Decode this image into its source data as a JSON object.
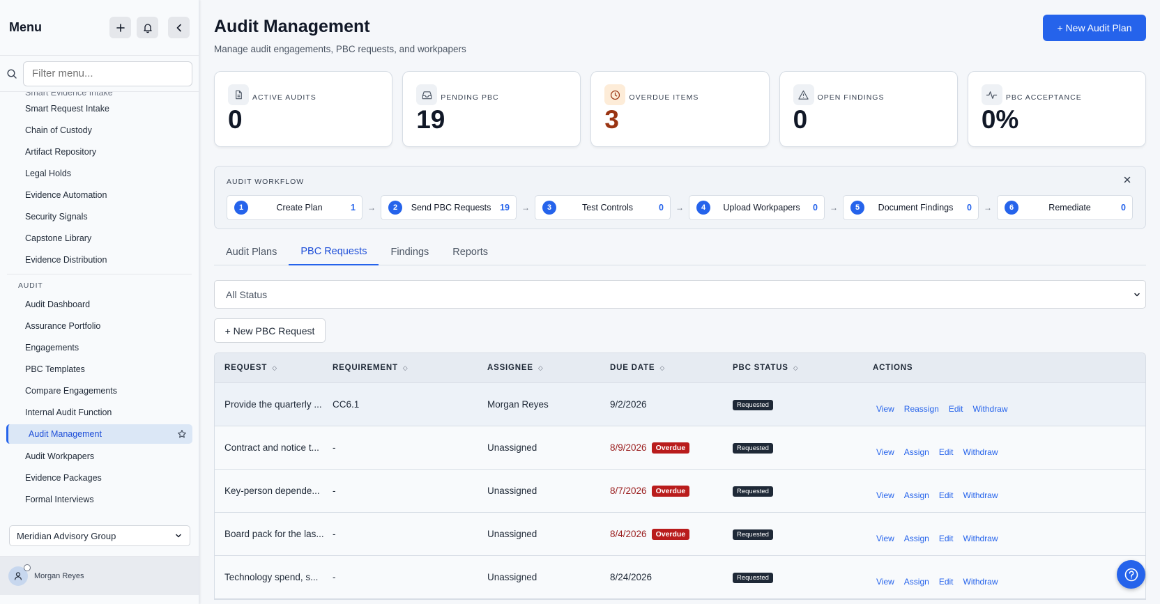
{
  "sidebar": {
    "title": "Menu",
    "filter_placeholder": "Filter menu...",
    "clipped_item": "Smart Evidence Intake",
    "items_top": [
      "Smart Request Intake",
      "Chain of Custody",
      "Artifact Repository",
      "Legal Holds",
      "Evidence Automation",
      "Security Signals",
      "Capstone Library",
      "Evidence Distribution"
    ],
    "section_label": "AUDIT",
    "items_audit_before": [
      "Audit Dashboard",
      "Assurance Portfolio",
      "Engagements",
      "PBC Templates",
      "Compare Engagements",
      "Internal Audit Function"
    ],
    "active_item": "Audit Management",
    "items_audit_after": [
      "Audit Workpapers",
      "Evidence Packages",
      "Formal Interviews"
    ],
    "organization": "Meridian Advisory Group",
    "user_name": "Morgan Reyes"
  },
  "header": {
    "title": "Audit Management",
    "subtitle": "Manage audit engagements, PBC requests, and workpapers",
    "new_plan_label": "+ New Audit Plan"
  },
  "stats": [
    {
      "label": "ACTIVE AUDITS",
      "value": "0",
      "icon": "document-icon"
    },
    {
      "label": "PENDING PBC",
      "value": "19",
      "icon": "inbox-icon"
    },
    {
      "label": "OVERDUE ITEMS",
      "value": "3",
      "icon": "clock-icon"
    },
    {
      "label": "OPEN FINDINGS",
      "value": "0",
      "icon": "alert-triangle-icon"
    },
    {
      "label": "PBC ACCEPTANCE",
      "value": "0%",
      "icon": "activity-icon"
    }
  ],
  "workflow": {
    "title": "AUDIT WORKFLOW",
    "arrow": "→",
    "steps": [
      {
        "num": "1",
        "label": "Create Plan",
        "count": "1"
      },
      {
        "num": "2",
        "label": "Send PBC Requests",
        "count": "19"
      },
      {
        "num": "3",
        "label": "Test Controls",
        "count": "0"
      },
      {
        "num": "4",
        "label": "Upload Workpapers",
        "count": "0"
      },
      {
        "num": "5",
        "label": "Document Findings",
        "count": "0"
      },
      {
        "num": "6",
        "label": "Remediate",
        "count": "0"
      }
    ]
  },
  "tabs": [
    "Audit Plans",
    "PBC Requests",
    "Findings",
    "Reports"
  ],
  "active_tab": "PBC Requests",
  "filter": {
    "status_selected": "All Status"
  },
  "new_pbc_label": "+ New PBC Request",
  "table": {
    "headers": [
      "REQUEST",
      "REQUIREMENT",
      "ASSIGNEE",
      "DUE DATE",
      "PBC STATUS",
      "ACTIONS"
    ],
    "sort_glyph": "◇",
    "overdue_label": "Overdue",
    "rows": [
      {
        "request": "Provide the quarterly ...",
        "requirement": "CC6.1",
        "assignee": "Morgan Reyes",
        "due": "9/2/2026",
        "overdue": false,
        "status": "Requested",
        "actions": [
          "View",
          "Reassign",
          "Edit",
          "Withdraw"
        ]
      },
      {
        "request": "Contract and notice t...",
        "requirement": "-",
        "assignee": "Unassigned",
        "due": "8/9/2026",
        "overdue": true,
        "status": "Requested",
        "actions": [
          "View",
          "Assign",
          "Edit",
          "Withdraw"
        ]
      },
      {
        "request": "Key-person depende...",
        "requirement": "-",
        "assignee": "Unassigned",
        "due": "8/7/2026",
        "overdue": true,
        "status": "Requested",
        "actions": [
          "View",
          "Assign",
          "Edit",
          "Withdraw"
        ]
      },
      {
        "request": "Board pack for the las...",
        "requirement": "-",
        "assignee": "Unassigned",
        "due": "8/4/2026",
        "overdue": true,
        "status": "Requested",
        "actions": [
          "View",
          "Assign",
          "Edit",
          "Withdraw"
        ]
      },
      {
        "request": "Technology spend, s...",
        "requirement": "-",
        "assignee": "Unassigned",
        "due": "8/24/2026",
        "overdue": false,
        "status": "Requested",
        "actions": [
          "View",
          "Assign",
          "Edit",
          "Withdraw"
        ]
      }
    ]
  },
  "colors": {
    "accent": "#2563eb",
    "overdue": "#b91c1c",
    "warning": "#9a3412"
  }
}
